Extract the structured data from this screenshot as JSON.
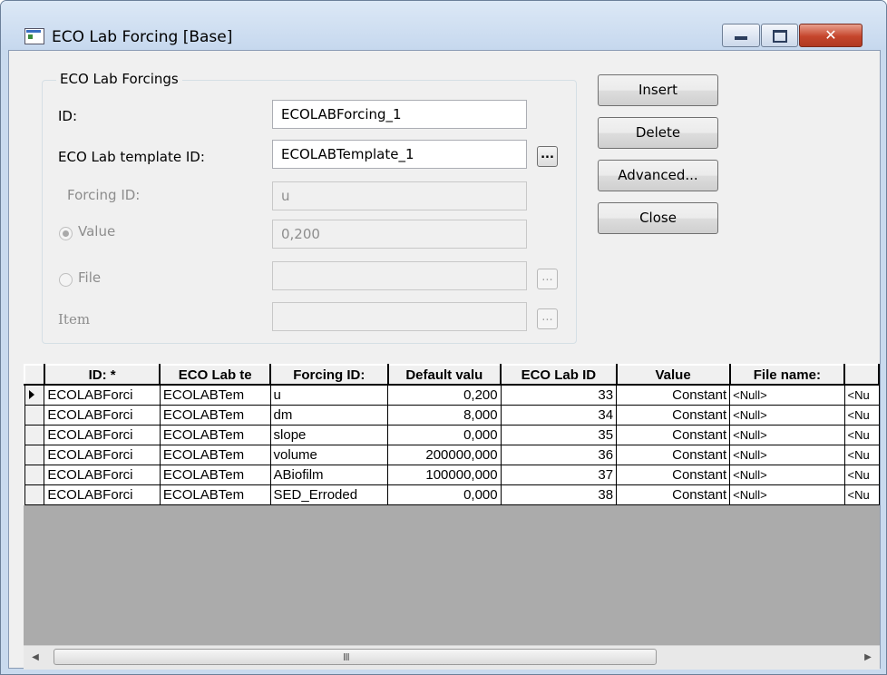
{
  "window": {
    "title": "ECO Lab Forcing [Base]",
    "close_glyph": "✕",
    "app_icon": "dialog-window-icon",
    "accent_close": "#c5452c"
  },
  "group": {
    "title": "ECO Lab Forcings",
    "id_label": "ID:",
    "id_value": "ECOLABForcing_1",
    "template_label": "ECO Lab template ID:",
    "template_value": "ECOLABTemplate_1",
    "forcing_label": "Forcing ID:",
    "forcing_value": "u",
    "value_label": "Value",
    "value_value": "0,200",
    "file_label": "File",
    "file_value": "",
    "item_label": "Item",
    "item_value": "",
    "browse_label": "..."
  },
  "buttons": {
    "insert": "Insert",
    "delete": "Delete",
    "advanced": "Advanced...",
    "close": "Close"
  },
  "table": {
    "columns": [
      "ID: *",
      "ECO Lab te",
      "Forcing ID:",
      "Default valu",
      "ECO Lab ID",
      "Value",
      "File name:",
      ""
    ],
    "rows": [
      [
        "ECOLABForci",
        "ECOLABTem",
        "u",
        "0,200",
        "33",
        "Constant",
        "<Null>",
        "<Nu"
      ],
      [
        "ECOLABForci",
        "ECOLABTem",
        "dm",
        "8,000",
        "34",
        "Constant",
        "<Null>",
        "<Nu"
      ],
      [
        "ECOLABForci",
        "ECOLABTem",
        "slope",
        "0,000",
        "35",
        "Constant",
        "<Null>",
        "<Nu"
      ],
      [
        "ECOLABForci",
        "ECOLABTem",
        "volume",
        "200000,000",
        "36",
        "Constant",
        "<Null>",
        "<Nu"
      ],
      [
        "ECOLABForci",
        "ECOLABTem",
        "ABiofilm",
        "100000,000",
        "37",
        "Constant",
        "<Null>",
        "<Nu"
      ],
      [
        "ECOLABForci",
        "ECOLABTem",
        "SED_Erroded",
        "0,000",
        "38",
        "Constant",
        "<Null>",
        "<Nu"
      ]
    ]
  },
  "scrollbar": {
    "left_arrow": "◀",
    "right_arrow": "▶",
    "grip": "III"
  }
}
